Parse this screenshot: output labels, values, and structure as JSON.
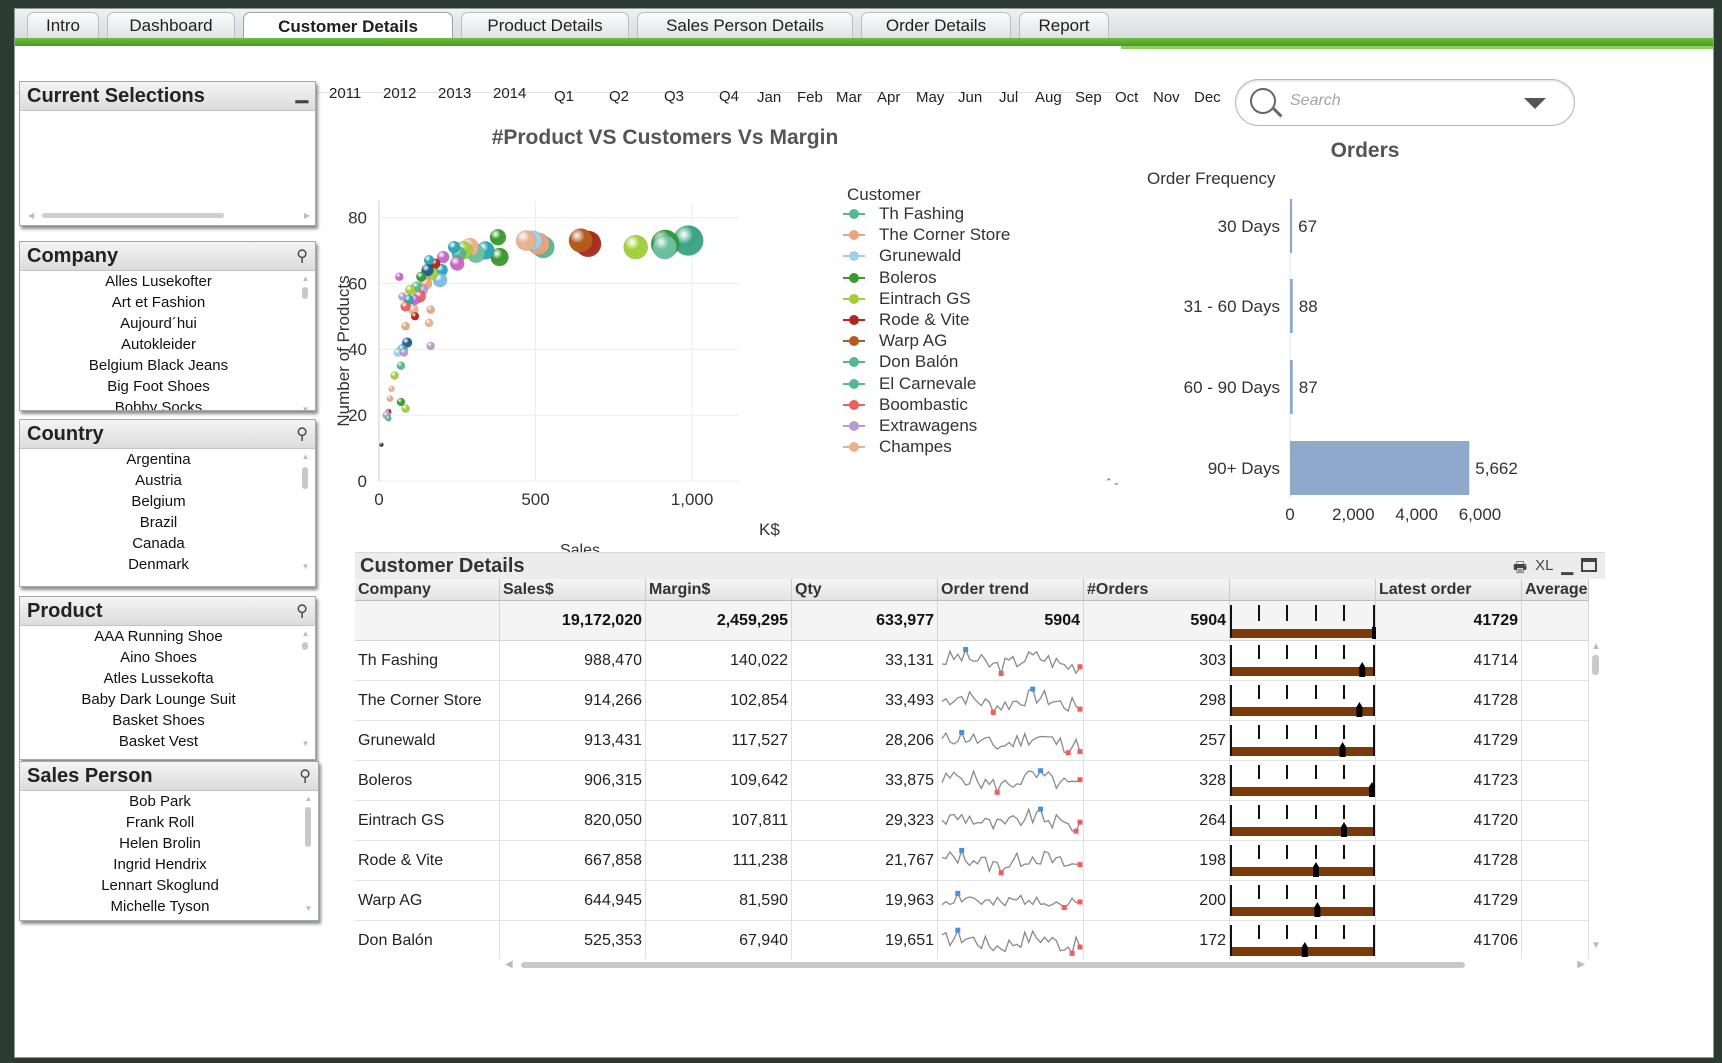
{
  "tabs": [
    {
      "label": "Intro",
      "active": false
    },
    {
      "label": "Dashboard",
      "active": false
    },
    {
      "label": "Customer Details",
      "active": true
    },
    {
      "label": "Product Details",
      "active": false
    },
    {
      "label": "Sales Person Details",
      "active": false
    },
    {
      "label": "Order Details",
      "active": false
    },
    {
      "label": "Report",
      "active": false
    }
  ],
  "current_selections": {
    "title": "Current Selections",
    "minimize_icon": "minimize-icon"
  },
  "listboxes": [
    {
      "title": "Company",
      "icon": "search-icon",
      "items": [
        "Alles Lusekofter",
        "Art et Fashion",
        "Aujourd´hui",
        "Autokleider",
        "Belgium Black Jeans",
        "Big Foot Shoes",
        "Bobby Socks"
      ]
    },
    {
      "title": "Country",
      "icon": "search-icon",
      "items": [
        "Argentina",
        "Austria",
        "Belgium",
        "Brazil",
        "Canada",
        "Denmark"
      ]
    },
    {
      "title": "Product",
      "icon": "search-icon",
      "items": [
        "AAA Running Shoe",
        "Aino Shoes",
        "Atles Lussekofta",
        "Baby Dark Lounge Suit",
        "Basket Shoes",
        "Basket Vest"
      ]
    },
    {
      "title": "Sales Person",
      "icon": "search-icon",
      "items": [
        "Bob Park",
        "Frank Roll",
        "Helen Brolin",
        "Ingrid Hendrix",
        "Lennart Skoglund",
        "Michelle Tyson"
      ]
    }
  ],
  "time_filters": {
    "years": [
      "2011",
      "2012",
      "2013",
      "2014"
    ],
    "quarters": [
      "Q1",
      "Q2",
      "Q3",
      "Q4"
    ],
    "months": [
      "Jan",
      "Feb",
      "Mar",
      "Apr",
      "May",
      "Jun",
      "Jul",
      "Aug",
      "Sep",
      "Oct",
      "Nov",
      "Dec"
    ]
  },
  "search": {
    "placeholder": "Search"
  },
  "chart_data": [
    {
      "type": "scatter",
      "title": "#Product VS Customers Vs Margin",
      "xlabel": "Sales",
      "ylabel": "Number of Products",
      "x_unit": "K$",
      "xlim": [
        0,
        1150
      ],
      "ylim": [
        0,
        85
      ],
      "xticks": [
        "0",
        "500",
        "1,000"
      ],
      "yticks": [
        "0",
        "20",
        "40",
        "60",
        "80"
      ],
      "legend_title": "Customer",
      "legend": [
        {
          "name": "Th Fashing",
          "color": "#55b890"
        },
        {
          "name": "The Corner Store",
          "color": "#e8a47e"
        },
        {
          "name": "Grunewald",
          "color": "#9fd0e6"
        },
        {
          "name": "Boleros",
          "color": "#3b9a2e"
        },
        {
          "name": "Eintrach GS",
          "color": "#a2cf3a"
        },
        {
          "name": "Rode & Vite",
          "color": "#b3261e"
        },
        {
          "name": "Warp AG",
          "color": "#b45a1b"
        },
        {
          "name": "Don Balón",
          "color": "#55b890"
        },
        {
          "name": "El Carnevale",
          "color": "#55b890"
        },
        {
          "name": "Boombastic",
          "color": "#e8625a"
        },
        {
          "name": "Extrawagens",
          "color": "#b99ad4"
        },
        {
          "name": "Champes",
          "color": "#e8b28e"
        }
      ],
      "points": [
        {
          "x": 988,
          "y": 73,
          "r": 15,
          "color": "#3aa583"
        },
        {
          "x": 914,
          "y": 72,
          "r": 14,
          "color": "#2f9a3b"
        },
        {
          "x": 913,
          "y": 71,
          "r": 12,
          "color": "#6cc0a0"
        },
        {
          "x": 820,
          "y": 71,
          "r": 12,
          "color": "#a2cf3a"
        },
        {
          "x": 668,
          "y": 72,
          "r": 13,
          "color": "#a8281f"
        },
        {
          "x": 645,
          "y": 73,
          "r": 12,
          "color": "#b45a1b"
        },
        {
          "x": 525,
          "y": 71,
          "r": 11,
          "color": "#55b890"
        },
        {
          "x": 510,
          "y": 72,
          "r": 11,
          "color": "#e8a47e"
        },
        {
          "x": 490,
          "y": 73,
          "r": 10,
          "color": "#9fd0e6"
        },
        {
          "x": 470,
          "y": 73,
          "r": 10,
          "color": "#e8b28e"
        },
        {
          "x": 380,
          "y": 74,
          "r": 8,
          "color": "#3b9a2e"
        },
        {
          "x": 385,
          "y": 68,
          "r": 9,
          "color": "#3b9a2e"
        },
        {
          "x": 340,
          "y": 70,
          "r": 9,
          "color": "#2ba6b8"
        },
        {
          "x": 310,
          "y": 69,
          "r": 9,
          "color": "#6cc0a0"
        },
        {
          "x": 290,
          "y": 71,
          "r": 9,
          "color": "#e8b28e"
        },
        {
          "x": 270,
          "y": 70,
          "r": 9,
          "color": "#a2cf3a"
        },
        {
          "x": 255,
          "y": 69,
          "r": 7,
          "color": "#55b890"
        },
        {
          "x": 240,
          "y": 71,
          "r": 6,
          "color": "#2ba6b8"
        },
        {
          "x": 250,
          "y": 66,
          "r": 7,
          "color": "#c966c9"
        },
        {
          "x": 205,
          "y": 68,
          "r": 6,
          "color": "#c966c9"
        },
        {
          "x": 200,
          "y": 64,
          "r": 6,
          "color": "#2ba6b8"
        },
        {
          "x": 195,
          "y": 61,
          "r": 7,
          "color": "#7dbbe8"
        },
        {
          "x": 180,
          "y": 66,
          "r": 5,
          "color": "#b3261e"
        },
        {
          "x": 170,
          "y": 63,
          "r": 6,
          "color": "#a2cf3a"
        },
        {
          "x": 160,
          "y": 67,
          "r": 5,
          "color": "#2ba6b8"
        },
        {
          "x": 155,
          "y": 64,
          "r": 6,
          "color": "#1f5f8b"
        },
        {
          "x": 150,
          "y": 60,
          "r": 6,
          "color": "#e8a47e"
        },
        {
          "x": 140,
          "y": 58,
          "r": 5,
          "color": "#b99ad4"
        },
        {
          "x": 135,
          "y": 62,
          "r": 5,
          "color": "#2f9a3b"
        },
        {
          "x": 130,
          "y": 56,
          "r": 6,
          "color": "#e8625a"
        },
        {
          "x": 120,
          "y": 59,
          "r": 5,
          "color": "#55b890"
        },
        {
          "x": 115,
          "y": 55,
          "r": 5,
          "color": "#c966c9"
        },
        {
          "x": 110,
          "y": 52,
          "r": 5,
          "color": "#e8b28e"
        },
        {
          "x": 100,
          "y": 58,
          "r": 5,
          "color": "#a2cf3a"
        },
        {
          "x": 95,
          "y": 55,
          "r": 5,
          "color": "#2ba6b8"
        },
        {
          "x": 85,
          "y": 53,
          "r": 5,
          "color": "#e8625a"
        },
        {
          "x": 75,
          "y": 56,
          "r": 4,
          "color": "#b99ad4"
        },
        {
          "x": 65,
          "y": 62,
          "r": 4,
          "color": "#c966c9"
        },
        {
          "x": 165,
          "y": 52,
          "r": 4,
          "color": "#e8a47e"
        },
        {
          "x": 160,
          "y": 48,
          "r": 4,
          "color": "#e8b28e"
        },
        {
          "x": 115,
          "y": 50,
          "r": 4,
          "color": "#b3261e"
        },
        {
          "x": 85,
          "y": 47,
          "r": 4,
          "color": "#e8a47e"
        },
        {
          "x": 165,
          "y": 41,
          "r": 4,
          "color": "#b99ad4"
        },
        {
          "x": 90,
          "y": 42,
          "r": 5,
          "color": "#1f5f8b"
        },
        {
          "x": 75,
          "y": 40,
          "r": 5,
          "color": "#2ba6b8"
        },
        {
          "x": 60,
          "y": 39,
          "r": 4,
          "color": "#9fd0e6"
        },
        {
          "x": 80,
          "y": 39,
          "r": 4,
          "color": "#b99ad4"
        },
        {
          "x": 70,
          "y": 35,
          "r": 4,
          "color": "#55b890"
        },
        {
          "x": 50,
          "y": 32,
          "r": 4,
          "color": "#a2cf3a"
        },
        {
          "x": 40,
          "y": 28,
          "r": 3,
          "color": "#e8b28e"
        },
        {
          "x": 35,
          "y": 25,
          "r": 3,
          "color": "#e8a47e"
        },
        {
          "x": 70,
          "y": 24,
          "r": 4,
          "color": "#3b9a2e"
        },
        {
          "x": 85,
          "y": 22,
          "r": 4,
          "color": "#a2cf3a"
        },
        {
          "x": 30,
          "y": 21,
          "r": 3,
          "color": "#b3261e"
        },
        {
          "x": 25,
          "y": 20,
          "r": 4,
          "color": "#b99ad4"
        },
        {
          "x": 30,
          "y": 19,
          "r": 3,
          "color": "#55b890"
        },
        {
          "x": 8,
          "y": 11,
          "r": 2,
          "color": "#333333"
        }
      ]
    },
    {
      "type": "bar",
      "orientation": "horizontal",
      "title": "Orders",
      "dimension_label": "Order Frequency",
      "categories": [
        "30 Days",
        "31 - 60 Days",
        "60 - 90 Days",
        "90+ Days"
      ],
      "values": [
        67,
        88,
        87,
        5662
      ],
      "value_labels": [
        "67",
        "88",
        "87",
        "5,662"
      ],
      "xticks": [
        "0",
        "2,000",
        "4,000",
        "6,000"
      ],
      "xlim": [
        0,
        6000
      ],
      "bar_color": "#8fa9cc"
    }
  ],
  "table": {
    "title": "Customer Details",
    "tools": {
      "print": "printer-icon",
      "xl": "XL",
      "minimize": "minimize-icon",
      "maximize": "maximize-icon"
    },
    "headers": [
      "Company",
      "Sales$",
      "Margin$",
      "Qty",
      "Order trend",
      "#Orders",
      "",
      "Latest order",
      "Average"
    ],
    "totals": {
      "sales": "19,172,020",
      "margin": "2,459,295",
      "qty": "633,977",
      "order_trend": "5904",
      "orders": "5904",
      "latest": "41729"
    },
    "rows": [
      {
        "company": "Th Fashing",
        "sales": "988,470",
        "margin": "140,022",
        "qty": "33,131",
        "orders": "303",
        "latest": "41714",
        "gauge": 0.93
      },
      {
        "company": "The Corner Store",
        "sales": "914,266",
        "margin": "102,854",
        "qty": "33,493",
        "orders": "298",
        "latest": "41728",
        "gauge": 0.91
      },
      {
        "company": "Grunewald",
        "sales": "913,431",
        "margin": "117,527",
        "qty": "28,206",
        "orders": "257",
        "latest": "41729",
        "gauge": 0.79
      },
      {
        "company": "Boleros",
        "sales": "906,315",
        "margin": "109,642",
        "qty": "33,875",
        "orders": "328",
        "latest": "41723",
        "gauge": 1.0
      },
      {
        "company": "Eintrach GS",
        "sales": "820,050",
        "margin": "107,811",
        "qty": "29,323",
        "orders": "264",
        "latest": "41720",
        "gauge": 0.8
      },
      {
        "company": "Rode & Vite",
        "sales": "667,858",
        "margin": "111,238",
        "qty": "21,767",
        "orders": "198",
        "latest": "41728",
        "gauge": 0.6
      },
      {
        "company": "Warp AG",
        "sales": "644,945",
        "margin": "81,590",
        "qty": "19,963",
        "orders": "200",
        "latest": "41729",
        "gauge": 0.61
      },
      {
        "company": "Don Balón",
        "sales": "525,353",
        "margin": "67,940",
        "qty": "19,651",
        "orders": "172",
        "latest": "41706",
        "gauge": 0.52
      }
    ]
  }
}
